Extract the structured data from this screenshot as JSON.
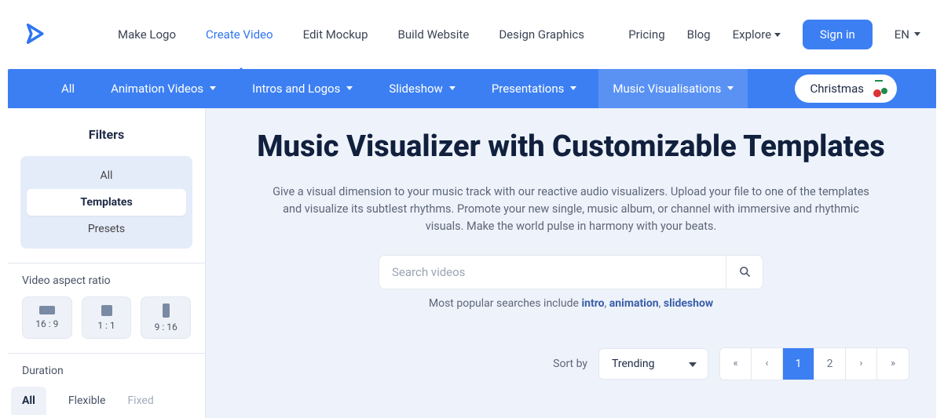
{
  "topnav": {
    "items": [
      {
        "label": "Make Logo"
      },
      {
        "label": "Create Video"
      },
      {
        "label": "Edit Mockup"
      },
      {
        "label": "Build Website"
      },
      {
        "label": "Design Graphics"
      }
    ],
    "right": {
      "pricing": "Pricing",
      "blog": "Blog",
      "explore": "Explore",
      "signin": "Sign in",
      "lang": "EN"
    }
  },
  "catbar": {
    "items": [
      {
        "label": "All"
      },
      {
        "label": "Animation Videos"
      },
      {
        "label": "Intros and Logos"
      },
      {
        "label": "Slideshow"
      },
      {
        "label": "Presentations"
      },
      {
        "label": "Music Visualisations"
      }
    ],
    "christmas": "Christmas"
  },
  "sidebar": {
    "title": "Filters",
    "mode": {
      "items": [
        "All",
        "Templates",
        "Presets"
      ],
      "selected": 1
    },
    "aspect": {
      "label": "Video aspect ratio",
      "options": [
        "16 : 9",
        "1 : 1",
        "9 : 16"
      ]
    },
    "duration": {
      "label": "Duration",
      "options": [
        "All",
        "Flexible",
        "Fixed"
      ]
    }
  },
  "main": {
    "title": "Music Visualizer with Customizable Templates",
    "desc": "Give a visual dimension to your music track with our reactive audio visualizers. Upload your file to one of the templates and visualize its subtlest rhythms. Promote your new single, music album, or channel with immersive and rhythmic visuals. Make the world pulse in harmony with your beats.",
    "search": {
      "placeholder": "Search videos"
    },
    "popular": {
      "prefix": "Most popular searches include ",
      "links": [
        "intro",
        "animation",
        "slideshow"
      ]
    },
    "sort": {
      "label": "Sort by",
      "value": "Trending"
    },
    "pager": {
      "pages": [
        "1",
        "2"
      ],
      "active": 0
    }
  }
}
